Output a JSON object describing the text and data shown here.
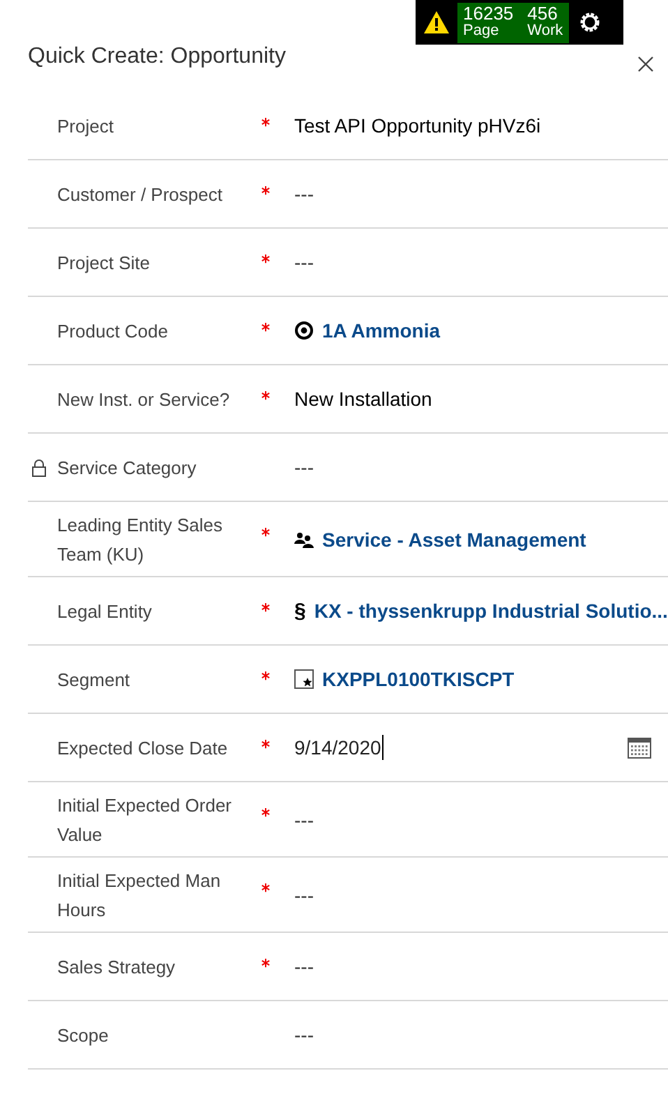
{
  "perf_bar": {
    "page_count": "16235",
    "page_label": "Page",
    "work_count": "456",
    "work_label": "Work"
  },
  "title": "Quick Create: Opportunity",
  "fields": [
    {
      "label": "Project",
      "required": true,
      "locked": false,
      "kind": "text",
      "value": "Test API Opportunity pHVz6i"
    },
    {
      "label": "Customer / Prospect",
      "required": true,
      "locked": false,
      "kind": "empty",
      "value": "---"
    },
    {
      "label": "Project Site",
      "required": true,
      "locked": false,
      "kind": "empty",
      "value": "---"
    },
    {
      "label": "Product Code",
      "required": true,
      "locked": false,
      "kind": "product-lookup",
      "value": "1A Ammonia"
    },
    {
      "label": "New Inst. or Service?",
      "required": true,
      "locked": false,
      "kind": "text",
      "value": "New Installation"
    },
    {
      "label": "Service Category",
      "required": false,
      "locked": true,
      "kind": "empty",
      "value": "---"
    },
    {
      "label": "Leading Entity Sales Team (KU)",
      "required": true,
      "locked": false,
      "kind": "team-lookup",
      "value": "Service - Asset Management"
    },
    {
      "label": "Legal Entity",
      "required": true,
      "locked": false,
      "kind": "legal-lookup",
      "symbol": "§",
      "value": "KX - thyssenkrupp Industrial Solutio..."
    },
    {
      "label": "Segment",
      "required": true,
      "locked": false,
      "kind": "segment-lookup",
      "value": "KXPPL0100TKISCPT"
    },
    {
      "label": "Expected Close Date",
      "required": true,
      "locked": false,
      "kind": "date",
      "value": "9/14/2020"
    },
    {
      "label": "Initial Expected Order Value",
      "required": true,
      "locked": false,
      "kind": "empty",
      "value": "---"
    },
    {
      "label": "Initial Expected Man Hours",
      "required": true,
      "locked": false,
      "kind": "empty",
      "value": "---"
    },
    {
      "label": "Sales Strategy",
      "required": true,
      "locked": false,
      "kind": "empty",
      "value": "---"
    },
    {
      "label": "Scope",
      "required": false,
      "locked": false,
      "kind": "empty",
      "value": "---"
    }
  ]
}
